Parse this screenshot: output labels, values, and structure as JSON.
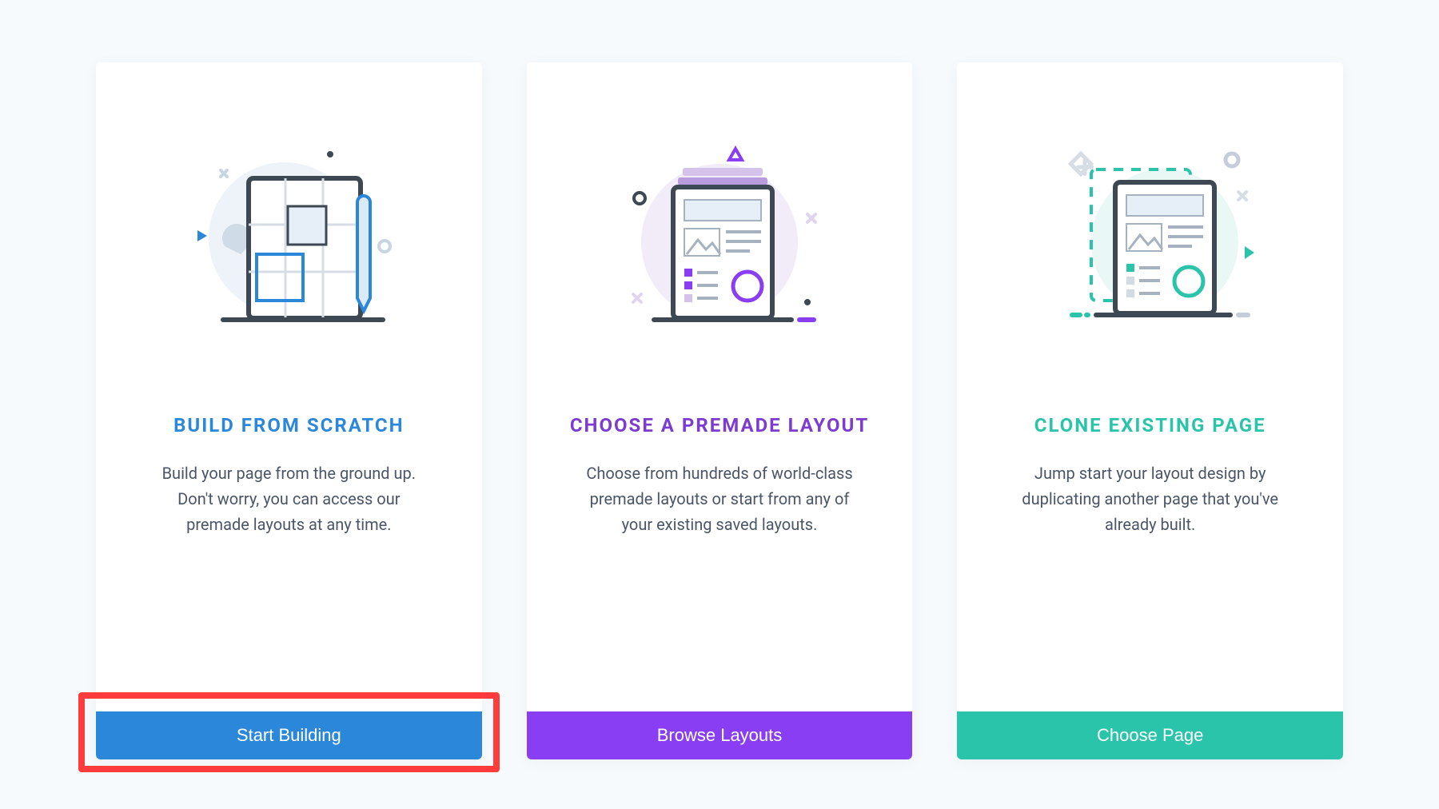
{
  "cards": [
    {
      "title": "BUILD FROM SCRATCH",
      "description": "Build your page from the ground up. Don't worry, you can access our premade layouts at any time.",
      "button": "Start Building"
    },
    {
      "title": "CHOOSE A PREMADE LAYOUT",
      "description": "Choose from hundreds of world-class premade layouts or start from any of your existing saved layouts.",
      "button": "Browse Layouts"
    },
    {
      "title": "CLONE EXISTING PAGE",
      "description": "Jump start your layout design by duplicating another page that you've already built.",
      "button": "Choose Page"
    }
  ],
  "highlighted_card_index": 0,
  "colors": {
    "blue": "#2b87da",
    "purple": "#7e3bd0",
    "teal": "#29c4a9"
  }
}
